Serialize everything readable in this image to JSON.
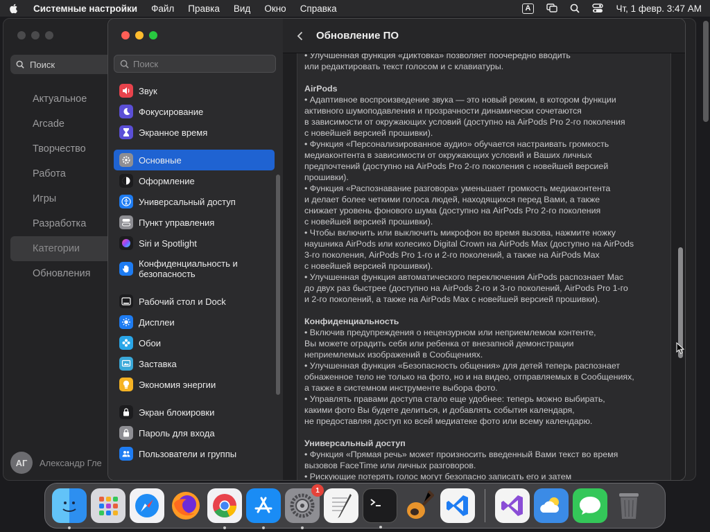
{
  "menubar": {
    "app_name": "Системные настройки",
    "items": [
      "Файл",
      "Правка",
      "Вид",
      "Окно",
      "Справка"
    ],
    "input_indicator": "A",
    "clock": "Чт, 1 февр.  3:47 AM"
  },
  "background_window": {
    "search_placeholder": "Поиск",
    "nav": [
      "Актуальное",
      "Arcade",
      "Творчество",
      "Работа",
      "Игры",
      "Разработка",
      "Категории",
      "Обновления"
    ],
    "selected": "Категории",
    "user_initials": "АГ",
    "user_name": "Александр Гле"
  },
  "sidebar": {
    "search_placeholder": "Поиск",
    "items": [
      {
        "label": "Звук",
        "icon": "speaker-icon",
        "color": "#e8434c"
      },
      {
        "label": "Фокусирование",
        "icon": "moon-icon",
        "color": "#5b4fd6"
      },
      {
        "label": "Экранное время",
        "icon": "hourglass-icon",
        "color": "#5b4fd6"
      },
      {
        "label": "Основные",
        "icon": "gear-icon",
        "color": "#8e8e93",
        "selected": true
      },
      {
        "label": "Оформление",
        "icon": "appearance-icon",
        "color": "#1c1c1e"
      },
      {
        "label": "Универсальный доступ",
        "icon": "accessibility-icon",
        "color": "#1e7cf2"
      },
      {
        "label": "Пункт управления",
        "icon": "control-center-icon",
        "color": "#8e8e93"
      },
      {
        "label": "Siri и Spotlight",
        "icon": "siri-icon",
        "color": "#b03fd6"
      },
      {
        "label": "Конфиденциальность и безопасность",
        "icon": "hand-icon",
        "color": "#1e7cf2"
      },
      {
        "label": "Рабочий стол и Dock",
        "icon": "dock-icon",
        "color": "#1c1c1e"
      },
      {
        "label": "Дисплеи",
        "icon": "sun-icon",
        "color": "#1e7cf2"
      },
      {
        "label": "Обои",
        "icon": "flower-icon",
        "color": "#2aa6e8"
      },
      {
        "label": "Заставка",
        "icon": "screensaver-icon",
        "color": "#3aa8d8"
      },
      {
        "label": "Экономия энергии",
        "icon": "bulb-icon",
        "color": "#f5b324"
      },
      {
        "label": "Экран блокировки",
        "icon": "lock-icon",
        "color": "#1c1c1e"
      },
      {
        "label": "Пароль для входа",
        "icon": "padlock-icon",
        "color": "#8e8e93"
      },
      {
        "label": "Пользователи и группы",
        "icon": "users-icon",
        "color": "#1e7cf2"
      }
    ]
  },
  "page": {
    "title": "Обновление ПО"
  },
  "notes": {
    "intro": "• Улучшенная функция «Диктовка» позволяет поочередно вводить\nили редактировать текст голосом и с клавиатуры.",
    "sections": [
      {
        "heading": "AirPods",
        "body": "• Адаптивное воспроизведение звука — это новый режим, в котором функции\nактивного шумоподавления и прозрачности динамически сочетаются\nв зависимости от окружающих условий (доступно на AirPods Pro 2-го поколения\nс новейшей версией прошивки).\n• Функция «Персонализированное аудио» обучается настраивать громкость\nмедиаконтента в зависимости от окружающих условий и Ваших личных\nпредпочтений (доступно на AirPods Pro 2-го поколения с новейшей версией\nпрошивки).\n• Функция «Распознавание разговора» уменьшает громкость медиаконтента\nи делает более четкими голоса людей, находящихся перед Вами, а также\nснижает уровень фонового шума (доступно на AirPods Pro 2-го поколения\nс новейшей версией прошивки).\n• Чтобы включить или выключить микрофон во время вызова, нажмите ножку\nнаушника AirPods или колесико Digital Crown на AirPods Max (доступно на AirPods\n3-го поколения, AirPods Pro 1-го и 2-го поколений, а также на AirPods Max\nс новейшей версией прошивки).\n• Улучшенная функция автоматического переключения AirPods распознает Mac\nдо двух раз быстрее (доступно на AirPods 2-го и 3-го поколений, AirPods Pro 1-го\nи 2-го поколений, а также на AirPods Max с новейшей версией прошивки)."
      },
      {
        "heading": "Конфиденциальность",
        "body": "• Включив предупреждения о нецензурном или неприемлемом контенте,\nВы можете оградить себя или ребенка от внезапной демонстрации\nнеприемлемых изображений в Сообщениях.\n• Улучшенная функция «Безопасность общения» для детей теперь распознает\nобнаженное тело не только на фото, но и на видео, отправляемых в Сообщениях,\nа также в системном инструменте выбора фото.\n• Управлять правами доступа стало еще удобнее: теперь можно выбирать,\nкакими фото Вы будете делиться, и добавлять события календаря,\nне предоставляя доступ ко всей медиатеке фото или всему календарю."
      },
      {
        "heading": "Универсальный доступ",
        "body": "• Функция «Прямая речь» может произносить введенный Вами текст во время\nвызовов FaceTime или личных разговоров.\n• Рискующие потерять голос могут безопасно записать его и затем"
      }
    ]
  },
  "dock": {
    "apps": [
      {
        "name": "finder",
        "color": "#2d8ff0",
        "running": true
      },
      {
        "name": "launchpad",
        "color": "#d9d9de",
        "running": false
      },
      {
        "name": "safari",
        "color": "#f2f2f5",
        "running": false
      },
      {
        "name": "firefox",
        "color": "#8a3fd6",
        "running": false
      },
      {
        "name": "chrome",
        "color": "#f2f2f5",
        "running": true
      },
      {
        "name": "app-store",
        "color": "#1a8cf5",
        "running": true
      },
      {
        "name": "system-settings",
        "color": "#8e8e93",
        "running": true,
        "badge": "1"
      },
      {
        "name": "textedit",
        "color": "#f4f4f4",
        "running": false
      },
      {
        "name": "terminal",
        "color": "#1c1c1e",
        "running": true
      },
      {
        "name": "garageband",
        "color": "#3a2a22",
        "running": false
      },
      {
        "name": "vscode",
        "color": "#f4f4f4",
        "running": false
      },
      {
        "name": "visual-studio",
        "color": "#f4f4f4",
        "running": false
      },
      {
        "name": "weather",
        "color": "#3b8be6",
        "running": false
      },
      {
        "name": "messages",
        "color": "#34c759",
        "running": false
      },
      {
        "name": "trash",
        "color": "#6a6a6e",
        "running": false
      }
    ]
  }
}
